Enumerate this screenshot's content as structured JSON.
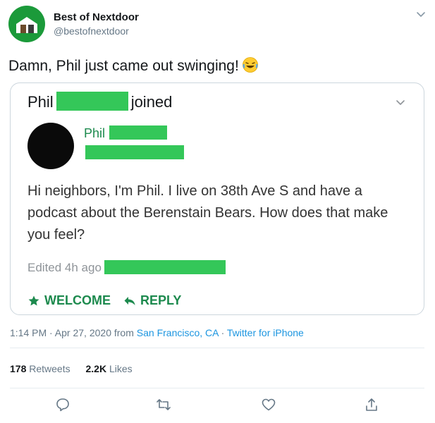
{
  "account": {
    "name": "Best of Nextdoor",
    "handle": "@bestofnextdoor"
  },
  "tweet": {
    "text": "Damn, Phil just came out swinging!"
  },
  "card": {
    "title_first": "Phil",
    "title_last": "joined",
    "poster_name": "Phil",
    "body": "Hi neighbors, I'm Phil. I live on 38th Ave S and have a podcast about the Berenstain Bears. How does that make you feel?",
    "edited": "Edited 4h ago",
    "welcome_label": "WELCOME",
    "reply_label": "REPLY"
  },
  "meta": {
    "time": "1:14 PM · Apr 27, 2020 from ",
    "location": "San Francisco, CA",
    "separator": " · ",
    "client": "Twitter for iPhone"
  },
  "stats": {
    "retweets_count": "178",
    "retweets_label": "Retweets",
    "likes_count": "2.2K",
    "likes_label": "Likes"
  },
  "colors": {
    "redaction": "#34c759",
    "nextdoor_green": "#1d8a4e",
    "twitter_blue": "#1b95e0",
    "muted": "#657786"
  },
  "icons": [
    "house-icon",
    "chevron-down-icon",
    "laughing-emoji-icon",
    "star-icon",
    "reply-arrow-icon",
    "comment-icon",
    "retweet-icon",
    "heart-icon",
    "share-icon"
  ]
}
